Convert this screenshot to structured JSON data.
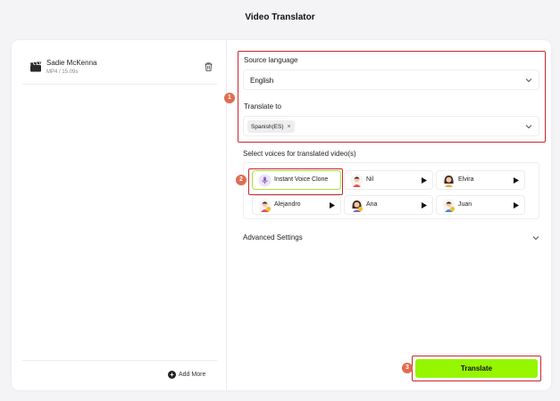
{
  "page": {
    "title": "Video Translator"
  },
  "file": {
    "name": "Sadie McKenna",
    "meta": "MP4 / 15.09s"
  },
  "left_footer": {
    "add_more_label": "Add More"
  },
  "source_language": {
    "label": "Source language",
    "value": "English"
  },
  "translate_to": {
    "label": "Translate to",
    "chips": [
      "Spanish(ES)"
    ],
    "chip_close": "×"
  },
  "voices": {
    "title": "Select voices for translated video(s)",
    "items": [
      {
        "name": "Instant Voice Clone",
        "selected": true
      },
      {
        "name": "Nil"
      },
      {
        "name": "Elvira"
      },
      {
        "name": "Alejandro"
      },
      {
        "name": "Ana"
      },
      {
        "name": "Juan"
      }
    ]
  },
  "advanced": {
    "label": "Advanced Settings"
  },
  "actions": {
    "translate_label": "Translate"
  },
  "steps": {
    "one": "1",
    "two": "2",
    "three": "3"
  },
  "colors": {
    "accent": "#95f600",
    "highlight": "#c8262e",
    "step_badge": "#e06c50"
  }
}
